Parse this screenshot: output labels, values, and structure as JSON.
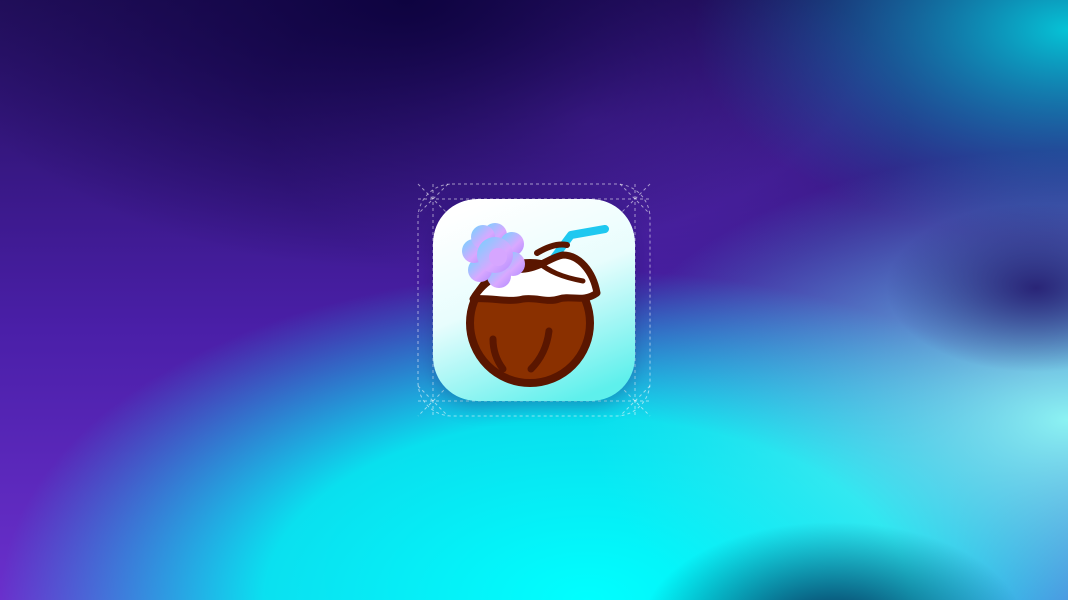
{
  "scene": {
    "description_free": true,
    "colors": {
      "bg_deep_indigo": "#140548",
      "bg_violet": "#6a2fc8",
      "bg_cyan": "#00f0f0",
      "bg_teal_dark": "#0a4a78",
      "icon_tile_top": "#ffffff",
      "icon_tile_bottom": "#5ff2ee",
      "coconut_shell": "#8a3000",
      "coconut_outline": "#5a1600",
      "coconut_flesh": "#ffffff",
      "straw": "#1ec8f0",
      "flower_light": "#7fd8ff",
      "flower_pink": "#e4a8ff",
      "guide_lines": "#ffffff"
    }
  },
  "icon": {
    "name": "coconut-drink-icon",
    "elements": [
      "coconut-icon",
      "flower-icon",
      "straw-icon"
    ]
  }
}
